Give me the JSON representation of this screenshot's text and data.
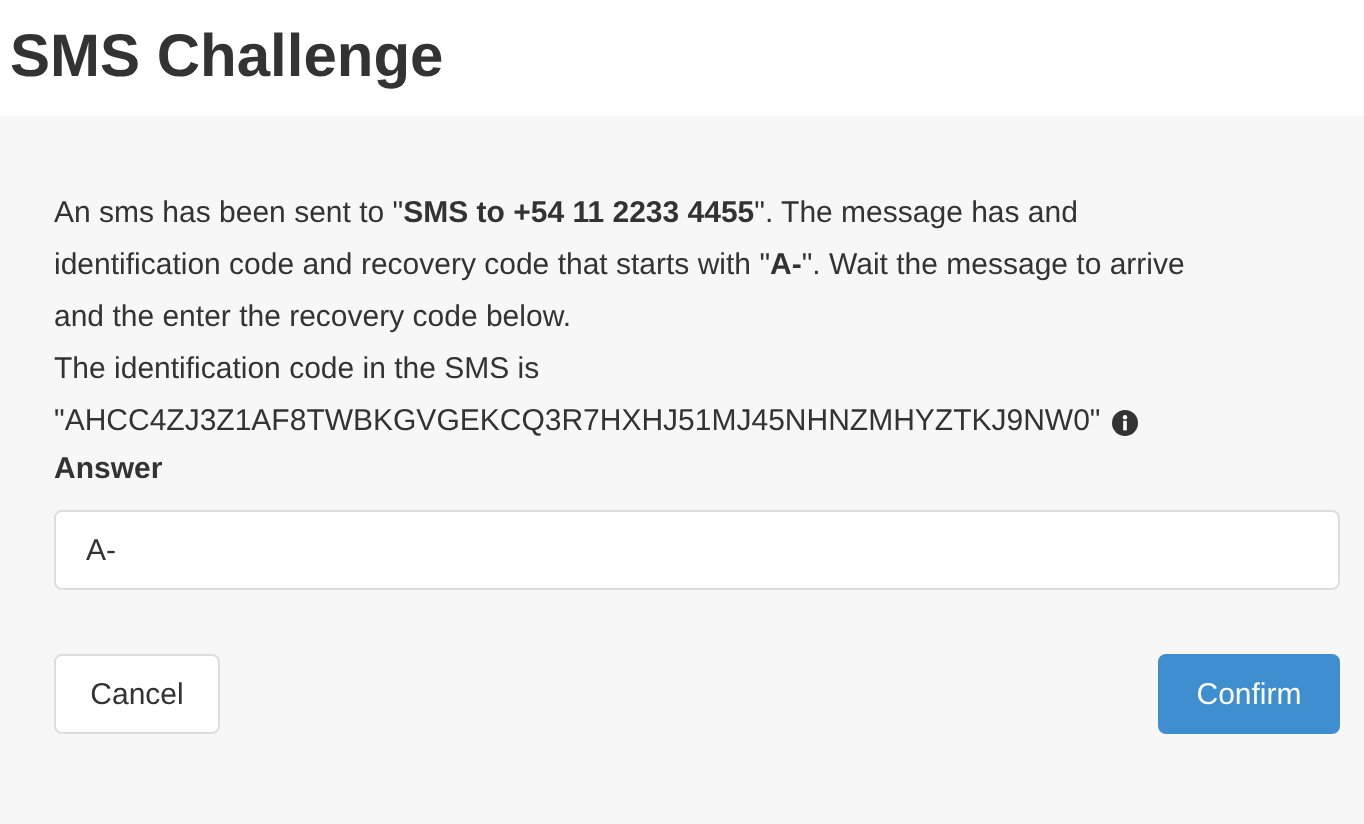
{
  "title": "SMS Challenge",
  "message": "An sms has been sent to \"**SMS to +54 11 2233 4455**\". The message has and identification code and recovery code that starts with \"**A-**\". Wait the message to arrive and the enter the recovery code below.",
  "identification_intro": "The identification code in the SMS is",
  "identification_code": "\"AHCC4ZJ3Z1AF8TWBKGVGEKCQ3R7HXHJ51MJ45NHNZMHYZTKJ9NW0\"",
  "answer": {
    "label": "Answer",
    "value": "A-"
  },
  "buttons": [
    {
      "label": "Cancel",
      "kind": "secondary"
    },
    {
      "label": "Confirm",
      "kind": "primary"
    }
  ]
}
